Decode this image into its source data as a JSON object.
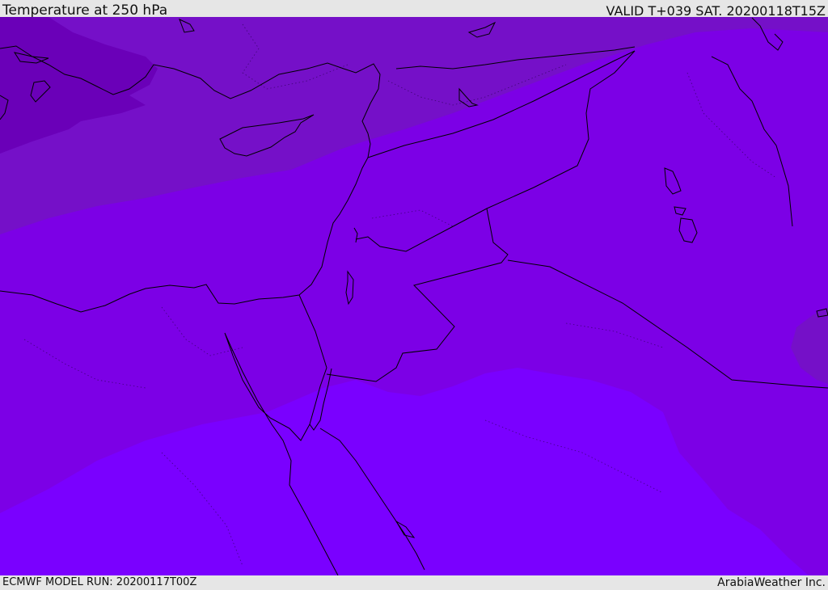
{
  "header": {
    "title": "Temperature at 250 hPa",
    "valid_time": "VALID T+039 SAT. 20200118T15Z"
  },
  "footer": {
    "model_run": "ECMWF MODEL RUN: 20200117T00Z",
    "credit": "ArabiaWeather Inc."
  },
  "map": {
    "parameter": "temperature-250hPa",
    "colors": {
      "band_coldest": "#6a00b8",
      "band_cold": "#7510c8",
      "band_mid": "#7c00e6",
      "band_warm": "#7a00ff",
      "coastline": "#000000"
    }
  }
}
